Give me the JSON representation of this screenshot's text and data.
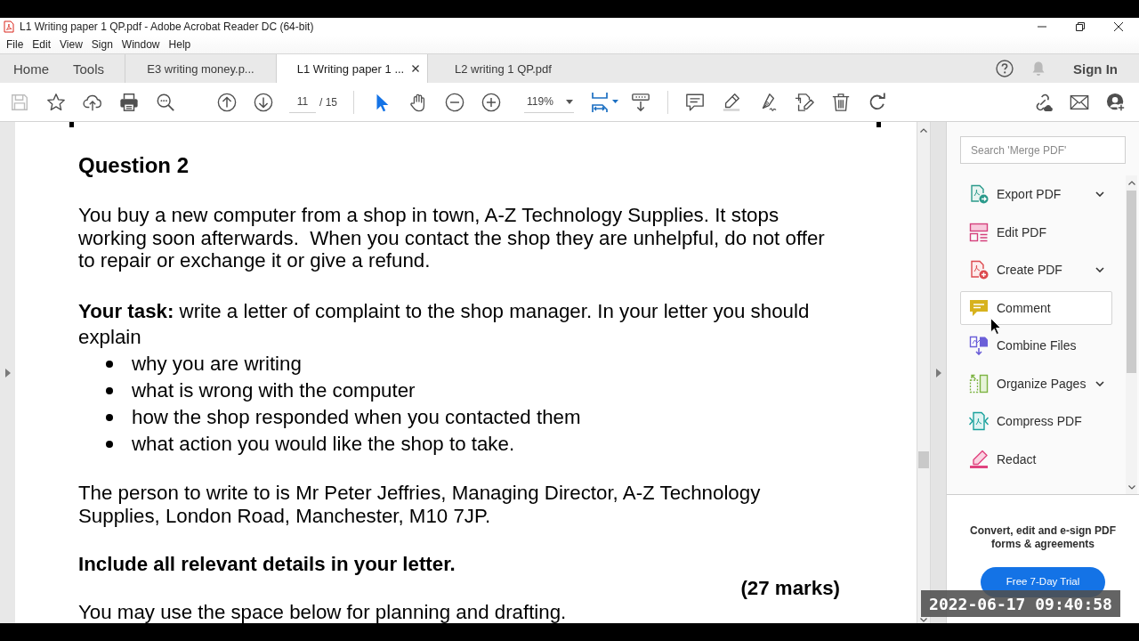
{
  "window": {
    "title": "L1 Writing paper 1 QP.pdf - Adobe Acrobat Reader DC (64-bit)"
  },
  "menu": [
    "File",
    "Edit",
    "View",
    "Sign",
    "Window",
    "Help"
  ],
  "nav": [
    "Home",
    "Tools"
  ],
  "tabs": [
    {
      "label": "E3 writing money.p...",
      "selected": false,
      "closable": false
    },
    {
      "label": "L1 Writing paper 1 ...",
      "selected": true,
      "closable": true
    },
    {
      "label": "L2 writing 1 QP.pdf",
      "selected": false,
      "closable": false
    }
  ],
  "account": {
    "sign_in": "Sign In"
  },
  "toolbar": {
    "save": {
      "disabled": true
    },
    "page_number": "11",
    "page_count": "/ 15",
    "tool_modes": [
      {
        "kind": "select",
        "selected": true
      },
      {
        "kind": "hand",
        "selected": false
      }
    ],
    "zoom": "119%"
  },
  "document": {
    "heading": "Question 2",
    "scenario": "You buy a new computer from a shop in town, A-Z Technology Supplies. It stops working soon afterwards.  When you contact the shop they are unhelpful, do not offer to repair or exchange it or give a refund.",
    "task": "**Your task:** write a letter of complaint to the shop manager. In your letter you should explain",
    "task_points": [
      "why you are writing",
      "what is wrong with the computer",
      "how the shop responded when you contacted them",
      "what action you would like the shop to take."
    ],
    "recipient": "The person to write to is Mr Peter Jeffries, Managing Director, A-Z Technology Supplies, London Road, Manchester, M10 7JP.",
    "instruction": "Include all relevant details in your letter.",
    "marks": "(27 marks)",
    "note": "You may use the space below for planning and drafting."
  },
  "tools_pane": {
    "search": {
      "placeholder": "Search 'Merge PDF'"
    },
    "tools": [
      {
        "kind": "export",
        "label": "Export PDF",
        "expandable": true,
        "hovered": false
      },
      {
        "kind": "edit",
        "label": "Edit PDF",
        "expandable": false,
        "hovered": false
      },
      {
        "kind": "create",
        "label": "Create PDF",
        "expandable": true,
        "hovered": false
      },
      {
        "kind": "comment",
        "label": "Comment",
        "expandable": false,
        "hovered": true
      },
      {
        "kind": "combine",
        "label": "Combine Files",
        "expandable": false,
        "hovered": false
      },
      {
        "kind": "organize",
        "label": "Organize Pages",
        "expandable": true,
        "hovered": false
      },
      {
        "kind": "compress",
        "label": "Compress PDF",
        "expandable": false,
        "hovered": false
      },
      {
        "kind": "redact",
        "label": "Redact",
        "expandable": false,
        "hovered": false
      }
    ]
  },
  "promo": {
    "text": "Convert, edit and e-sign PDF forms & agreements",
    "button": "Free 7-Day Trial"
  },
  "overlay": {
    "timestamp": "2022-06-17 09:40:58"
  }
}
